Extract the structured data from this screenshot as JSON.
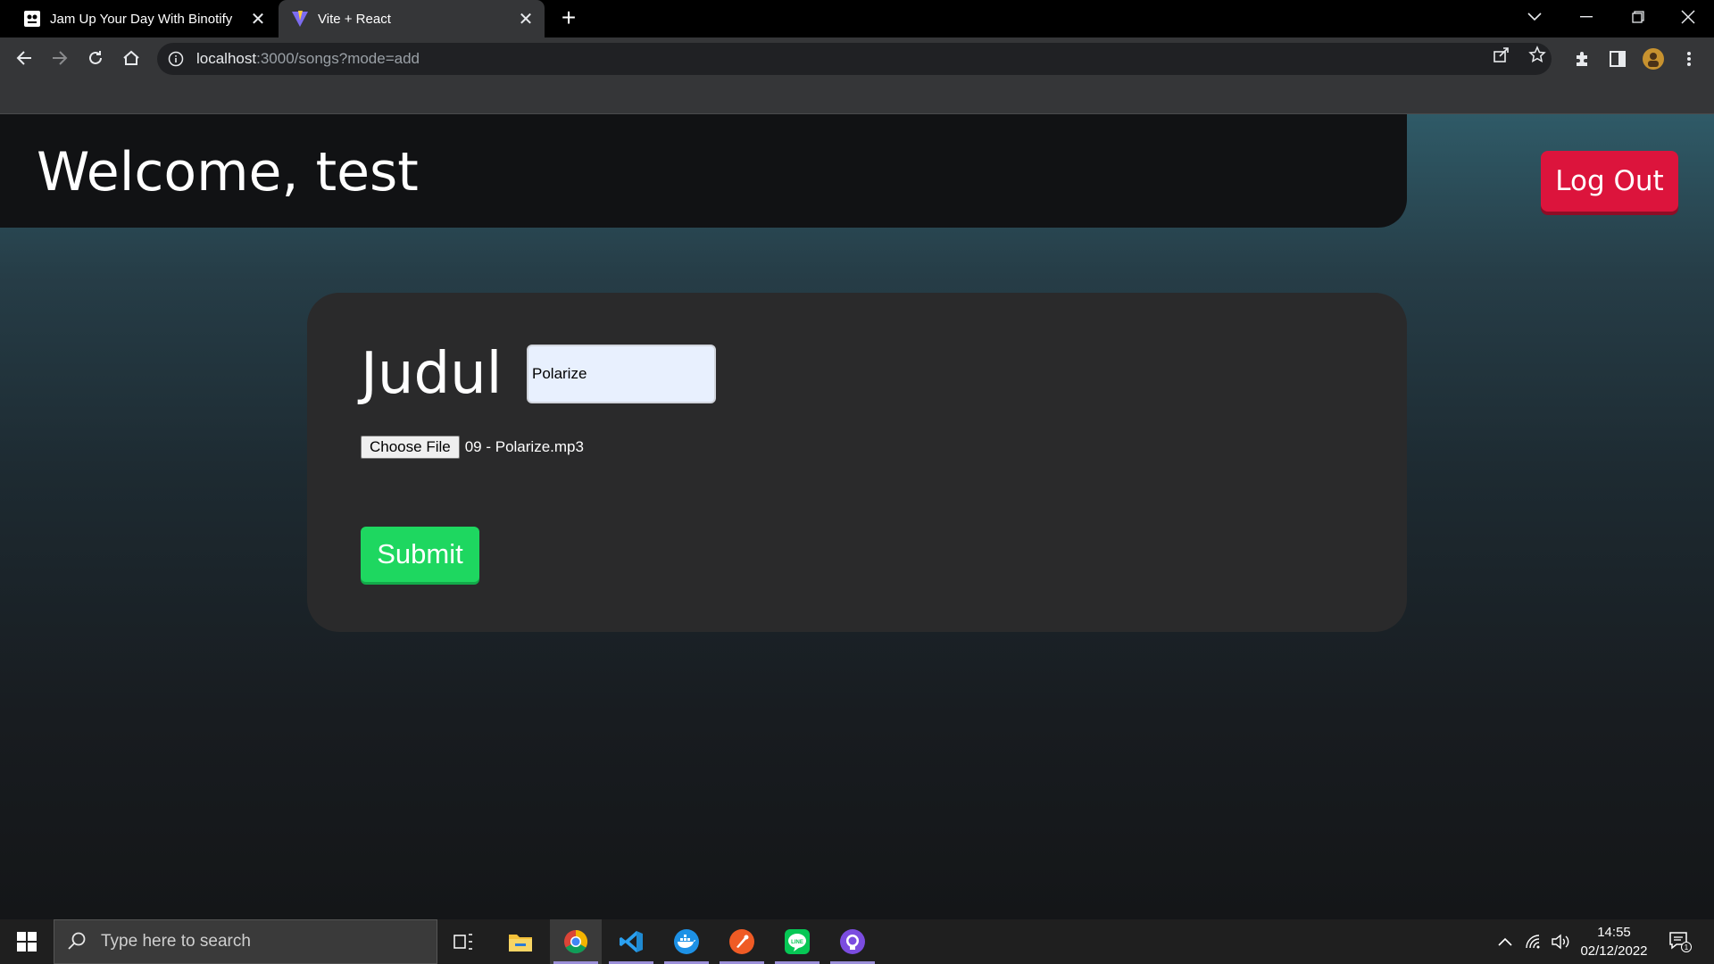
{
  "browser": {
    "tabs": [
      {
        "title": "Jam Up Your Day With Binotify",
        "active": false
      },
      {
        "title": "Vite + React",
        "active": true
      }
    ],
    "url": {
      "host": "localhost",
      "rest": ":3000/songs?mode=add"
    }
  },
  "page": {
    "welcome": "Welcome, test",
    "logout_label": "Log Out",
    "form": {
      "title_label": "Judul",
      "title_value": "Polarize",
      "choose_file_label": "Choose File",
      "file_name": "09 - Polarize.mp3",
      "submit_label": "Submit"
    }
  },
  "taskbar": {
    "search_placeholder": "Type here to search",
    "time": "14:55",
    "date": "02/12/2022",
    "notification_count": "1"
  },
  "colors": {
    "logout": "#dc143c",
    "submit": "#1ed760",
    "card": "#2a2a2b"
  }
}
